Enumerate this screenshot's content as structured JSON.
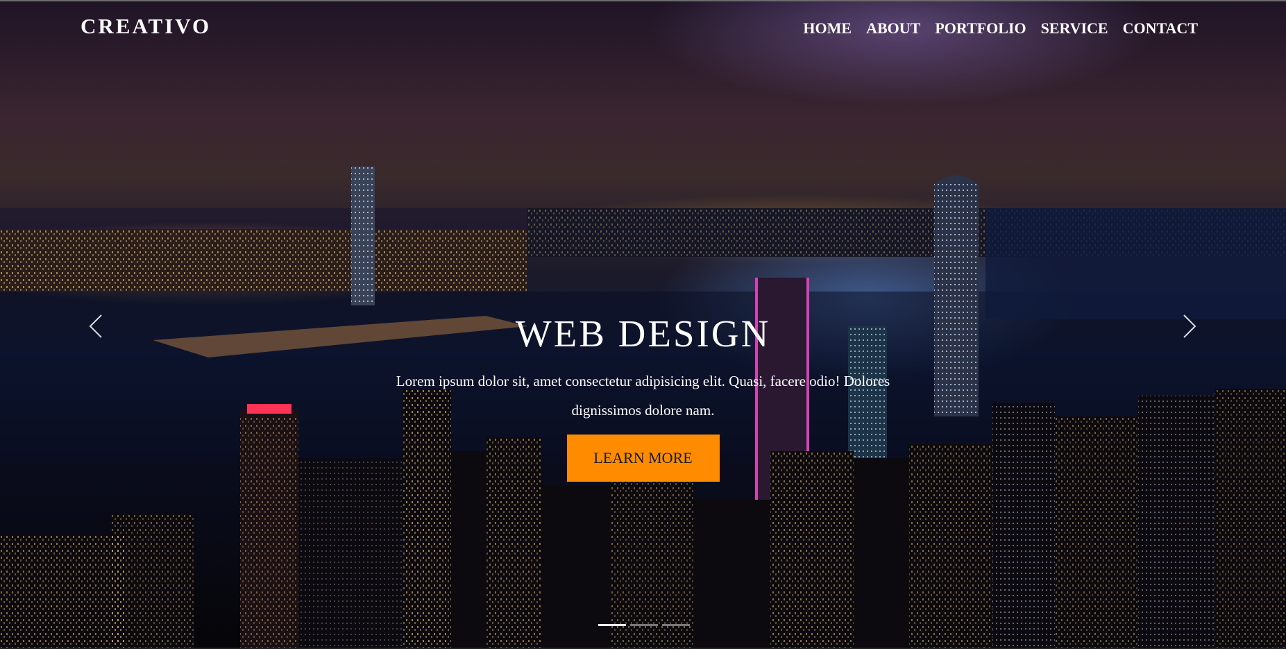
{
  "brand": {
    "logo": "CREATIVO"
  },
  "nav": {
    "items": [
      "HOME",
      "ABOUT",
      "PORTFOLIO",
      "SERVICE",
      "CONTACT"
    ]
  },
  "hero": {
    "title": "WEB DESIGN",
    "description": "Lorem ipsum dolor sit, amet consectetur adipisicing elit. Quasi, facere odio! Dolores dignissimos dolore nam.",
    "button_label": "LEARN MORE"
  },
  "carousel": {
    "slide_count": 3,
    "active_slide": 1,
    "prev_icon": "chevron-left-icon",
    "next_icon": "chevron-right-icon"
  },
  "colors": {
    "accent": "#ff8c00",
    "nav_text": "#ffffff",
    "button_text": "#1a1a1a"
  }
}
